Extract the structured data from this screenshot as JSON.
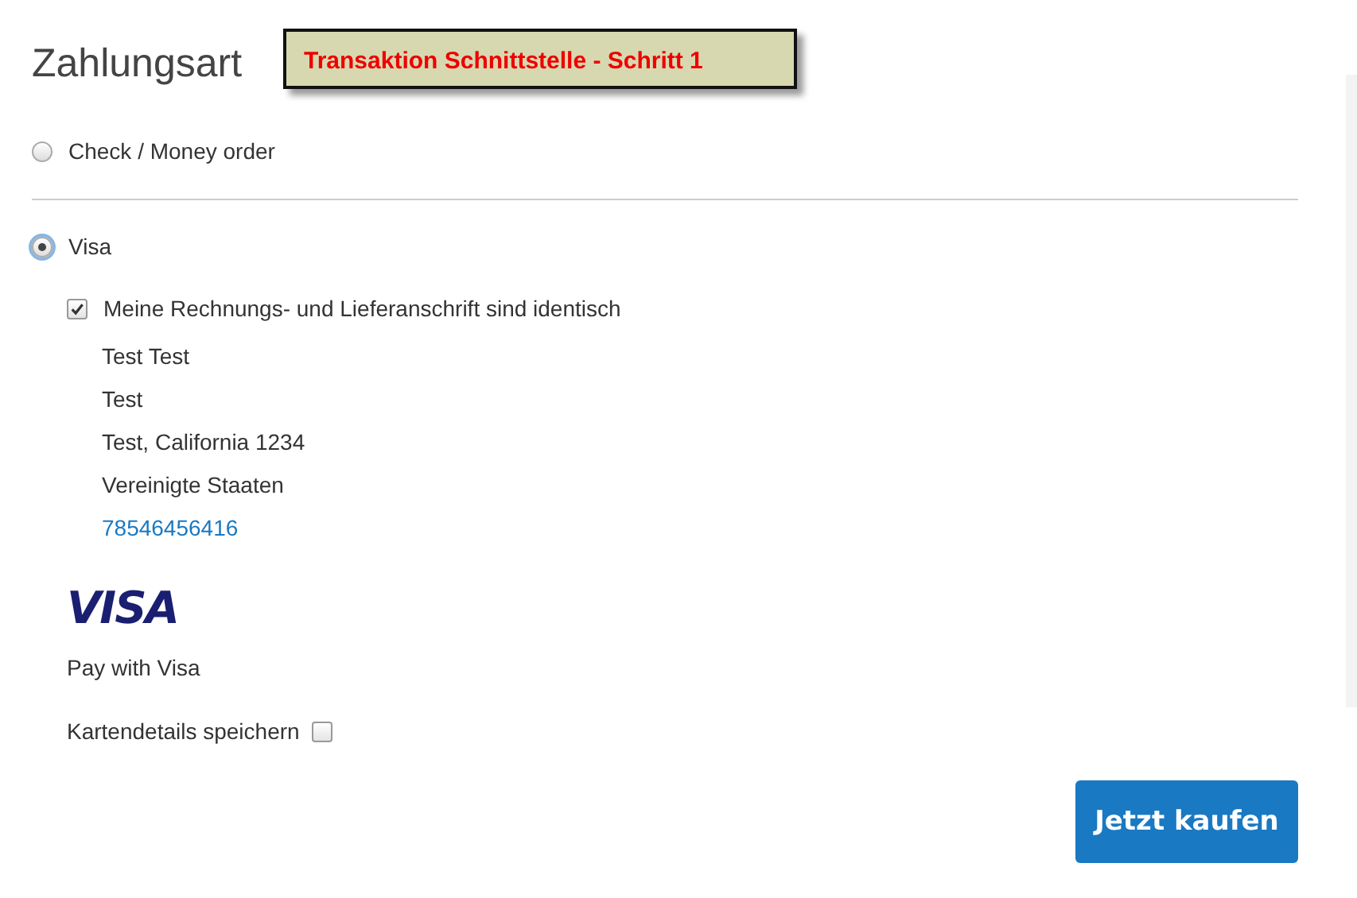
{
  "heading": "Zahlungsart",
  "callout": "Transaktion Schnittstelle - Schritt 1",
  "methods": [
    {
      "label": "Check / Money order",
      "selected": false
    },
    {
      "label": "Visa",
      "selected": true
    }
  ],
  "same_address": {
    "label": "Meine Rechnungs- und Lieferanschrift sind identisch",
    "checked": true
  },
  "address": [
    "Test Test",
    "Test",
    "Test, California 1234",
    "Vereinigte Staaten"
  ],
  "phone": "78546456416",
  "logo_text": "VISA",
  "pay_text": "Pay with Visa",
  "save_card": {
    "label": "Kartendetails speichern",
    "checked": false
  },
  "button": "Jetzt kaufen"
}
